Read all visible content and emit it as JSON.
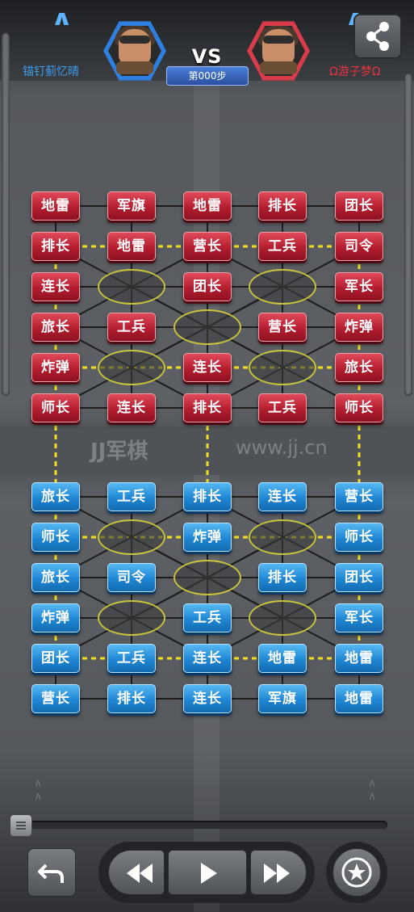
{
  "header": {
    "player_left": "锚钉蓟忆晴",
    "player_right": "Ω游子梦Ω",
    "vs_label": "VS",
    "step_label": "第000步",
    "left_name_color": "#3d9be9",
    "right_name_color": "#e8343f",
    "left_avatar_color": "#2f7fe0",
    "right_avatar_color": "#d83b4a",
    "share_icon": "share-icon",
    "back_icon": "chevron-up-icon"
  },
  "board": {
    "river_logo": "JJ军棋",
    "river_url": "www.jj.cn",
    "red_rows": [
      [
        "地雷",
        "军旗",
        "地雷",
        "排长",
        "团长"
      ],
      [
        "排长",
        "地雷",
        "营长",
        "工兵",
        "司令"
      ],
      [
        "连长",
        "",
        "团长",
        "",
        "军长"
      ],
      [
        "旅长",
        "工兵",
        "",
        "营长",
        "炸弹"
      ],
      [
        "炸弹",
        "",
        "连长",
        "",
        "旅长"
      ],
      [
        "师长",
        "连长",
        "排长",
        "工兵",
        "师长"
      ]
    ],
    "blue_rows": [
      [
        "旅长",
        "工兵",
        "排长",
        "连长",
        "营长"
      ],
      [
        "师长",
        "",
        "炸弹",
        "",
        "师长"
      ],
      [
        "旅长",
        "司令",
        "",
        "排长",
        "团长"
      ],
      [
        "炸弹",
        "",
        "工兵",
        "",
        "军长"
      ],
      [
        "团长",
        "工兵",
        "连长",
        "地雷",
        "地雷"
      ],
      [
        "营长",
        "排长",
        "连长",
        "军旗",
        "地雷"
      ]
    ]
  },
  "controls": {
    "undo_icon": "undo-arrow-icon",
    "rewind_icon": "rewind-icon",
    "play_icon": "play-icon",
    "fast_forward_icon": "fast-forward-icon",
    "star_icon": "star-icon",
    "replay_progress": 0
  }
}
